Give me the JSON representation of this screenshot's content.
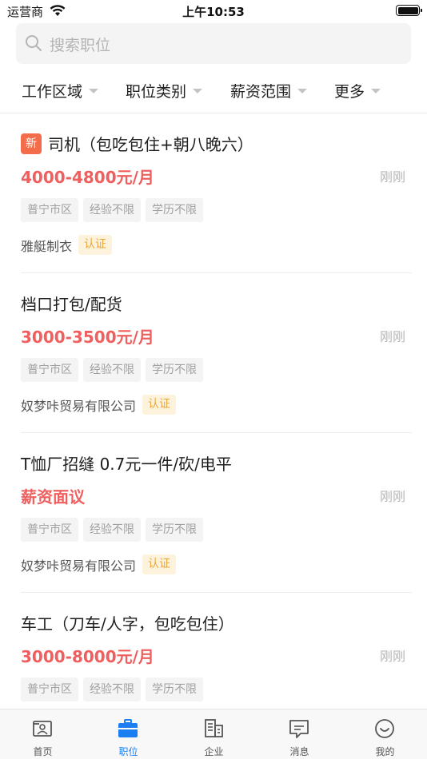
{
  "status_bar": {
    "carrier": "运营商",
    "time": "上午10:53"
  },
  "search": {
    "placeholder": "搜索职位"
  },
  "filters": [
    {
      "label": "工作区域"
    },
    {
      "label": "职位类别"
    },
    {
      "label": "薪资范围"
    },
    {
      "label": "更多"
    }
  ],
  "jobs": [
    {
      "is_new": true,
      "new_badge": "新",
      "title": "司机（包吃包住+朝八晚六）",
      "salary": "4000-4800元/月",
      "posted": "刚刚",
      "tags": [
        "普宁市区",
        "经验不限",
        "学历不限"
      ],
      "company": "雅艇制衣",
      "verified": "认证"
    },
    {
      "is_new": false,
      "title": "档口打包/配货",
      "salary": "3000-3500元/月",
      "posted": "刚刚",
      "tags": [
        "普宁市区",
        "经验不限",
        "学历不限"
      ],
      "company": "奴梦咔贸易有限公司",
      "verified": "认证"
    },
    {
      "is_new": false,
      "title": "T恤厂招缝 0.7元一件/砍/电平",
      "salary": "薪资面议",
      "posted": "刚刚",
      "tags": [
        "普宁市区",
        "经验不限",
        "学历不限"
      ],
      "company": "奴梦咔贸易有限公司",
      "verified": "认证"
    },
    {
      "is_new": false,
      "title": "车工（刀车/人字，包吃包住）",
      "salary": "3000-8000元/月",
      "posted": "刚刚",
      "tags": [
        "普宁市区",
        "经验不限",
        "学历不限"
      ],
      "company": "",
      "verified": ""
    }
  ],
  "tabs": [
    {
      "label": "首页",
      "icon": "home-icon",
      "active": false
    },
    {
      "label": "职位",
      "icon": "briefcase-icon",
      "active": true
    },
    {
      "label": "企业",
      "icon": "building-icon",
      "active": false
    },
    {
      "label": "消息",
      "icon": "message-icon",
      "active": false
    },
    {
      "label": "我的",
      "icon": "profile-icon",
      "active": false
    }
  ],
  "colors": {
    "accent": "#1b7ff1",
    "salary": "#ef5f5f",
    "new_badge": "#f46d4a",
    "verified_text": "#e8a73d",
    "verified_bg": "#fdf2dc"
  }
}
